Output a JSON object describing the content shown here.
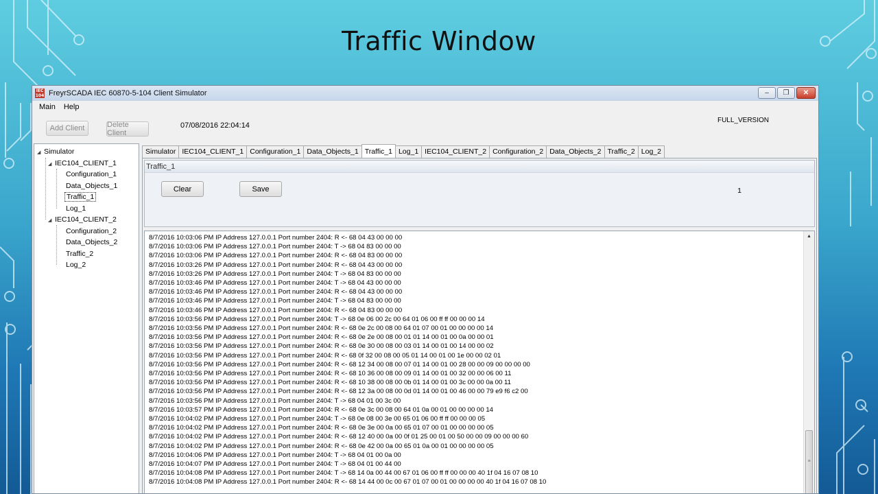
{
  "slide": {
    "title": "Traffic Window"
  },
  "window": {
    "title": "FreyrSCADA IEC 60870-5-104 Client Simulator",
    "icon_text": "IEC 104",
    "minimize": "–",
    "maximize": "❐",
    "close": "✕"
  },
  "menu": {
    "items": [
      "Main",
      "Help"
    ]
  },
  "toolbar": {
    "add_client": "Add Client",
    "delete_client": "Delete Client",
    "timestamp": "07/08/2016 22:04:14",
    "version": "FULL_VERSION"
  },
  "tree": {
    "root": "Simulator",
    "client1": "IEC104_CLIENT_1",
    "client1_children": [
      "Configuration_1",
      "Data_Objects_1",
      "Traffic_1",
      "Log_1"
    ],
    "client2": "IEC104_CLIENT_2",
    "client2_children": [
      "Configuration_2",
      "Data_Objects_2",
      "Traffic_2",
      "Log_2"
    ],
    "selected": "Traffic_1"
  },
  "tabs": [
    "Simulator",
    "IEC104_CLIENT_1",
    "Configuration_1",
    "Data_Objects_1",
    "Traffic_1",
    "Log_1",
    "IEC104_CLIENT_2",
    "Configuration_2",
    "Data_Objects_2",
    "Traffic_2",
    "Log_2"
  ],
  "active_tab": "Traffic_1",
  "traffic": {
    "group_title": "Traffic_1",
    "clear_label": "Clear",
    "save_label": "Save",
    "counter": "1"
  },
  "log_lines": [
    "8/7/2016 10:03:06 PM IP Address 127.0.0.1 Port number 2404:  R <- 68 04 43 00 00 00",
    "8/7/2016 10:03:06 PM IP Address 127.0.0.1 Port number 2404:  T -> 68 04 83 00 00 00",
    "8/7/2016 10:03:06 PM IP Address 127.0.0.1 Port number 2404:  R <- 68 04 83 00 00 00",
    "8/7/2016 10:03:26 PM IP Address 127.0.0.1 Port number 2404:  R <- 68 04 43 00 00 00",
    "8/7/2016 10:03:26 PM IP Address 127.0.0.1 Port number 2404:  T -> 68 04 83 00 00 00",
    "8/7/2016 10:03:46 PM IP Address 127.0.0.1 Port number 2404:  T -> 68 04 43 00 00 00",
    "8/7/2016 10:03:46 PM IP Address 127.0.0.1 Port number 2404:  R <- 68 04 43 00 00 00",
    "8/7/2016 10:03:46 PM IP Address 127.0.0.1 Port number 2404:  T -> 68 04 83 00 00 00",
    "8/7/2016 10:03:46 PM IP Address 127.0.0.1 Port number 2404:  R <- 68 04 83 00 00 00",
    "8/7/2016 10:03:56 PM IP Address 127.0.0.1 Port number 2404:  T -> 68 0e 06 00 2c 00 64 01 06 00 ff ff 00 00 00 14",
    "8/7/2016 10:03:56 PM IP Address 127.0.0.1 Port number 2404:  R <- 68 0e 2c 00 08 00 64 01 07 00 01 00 00 00 00 14",
    "8/7/2016 10:03:56 PM IP Address 127.0.0.1 Port number 2404:  R <- 68 0e 2e 00 08 00 01 01 14 00 01 00 0a 00 00 01",
    "8/7/2016 10:03:56 PM IP Address 127.0.0.1 Port number 2404:  R <- 68 0e 30 00 08 00 03 01 14 00 01 00 14 00 00 02",
    "8/7/2016 10:03:56 PM IP Address 127.0.0.1 Port number 2404:  R <- 68 0f 32 00 08 00 05 01 14 00 01 00 1e 00 00 02 01",
    "8/7/2016 10:03:56 PM IP Address 127.0.0.1 Port number 2404:  R <- 68 12 34 00 08 00 07 01 14 00 01 00 28 00 00 09 00 00 00 00",
    "8/7/2016 10:03:56 PM IP Address 127.0.0.1 Port number 2404:  R <- 68 10 36 00 08 00 09 01 14 00 01 00 32 00 00 06 00 11",
    "8/7/2016 10:03:56 PM IP Address 127.0.0.1 Port number 2404:  R <- 68 10 38 00 08 00 0b 01 14 00 01 00 3c 00 00 0a 00 11",
    "8/7/2016 10:03:56 PM IP Address 127.0.0.1 Port number 2404:  R <- 68 12 3a 00 08 00 0d 01 14 00 01 00 46 00 00 79 e9 f6 c2 00",
    "8/7/2016 10:03:56 PM IP Address 127.0.0.1 Port number 2404:  T -> 68 04 01 00 3c 00",
    "8/7/2016 10:03:57 PM IP Address 127.0.0.1 Port number 2404:  R <- 68 0e 3c 00 08 00 64 01 0a 00 01 00 00 00 00 14",
    "8/7/2016 10:04:02 PM IP Address 127.0.0.1 Port number 2404:  T -> 68 0e 08 00 3e 00 65 01 06 00 ff ff 00 00 00 05",
    "8/7/2016 10:04:02 PM IP Address 127.0.0.1 Port number 2404:  R <- 68 0e 3e 00 0a 00 65 01 07 00 01 00 00 00 00 05",
    "8/7/2016 10:04:02 PM IP Address 127.0.0.1 Port number 2404:  R <- 68 12 40 00 0a 00 0f 01 25 00 01 00 50 00 00 09 00 00 00 60",
    "8/7/2016 10:04:02 PM IP Address 127.0.0.1 Port number 2404:  R <- 68 0e 42 00 0a 00 65 01 0a 00 01 00 00 00 00 05",
    "8/7/2016 10:04:06 PM IP Address 127.0.0.1 Port number 2404:  T -> 68 04 01 00 0a 00",
    "8/7/2016 10:04:07 PM IP Address 127.0.0.1 Port number 2404:  T -> 68 04 01 00 44 00",
    "8/7/2016 10:04:08 PM IP Address 127.0.0.1 Port number 2404:  T -> 68 14 0a 00 44 00 67 01 06 00 ff ff 00 00 00 40 1f 04 16 07 08 10",
    "8/7/2016 10:04:08 PM IP Address 127.0.0.1 Port number 2404:  R <- 68 14 44 00 0c 00 67 01 07 00 01 00 00 00 00 40 1f 04 16 07 08 10"
  ],
  "colors": {
    "bg_top": "#5fcde0",
    "bg_bottom": "#135a96",
    "circuit": "#d8f2fb",
    "close_button": "#c8402a"
  },
  "icons": [
    "circuit-decoration",
    "app-icon",
    "minimize-icon",
    "maximize-icon",
    "close-icon",
    "tree-expand-icon",
    "scroll-up-icon",
    "scroll-grip-icon"
  ]
}
